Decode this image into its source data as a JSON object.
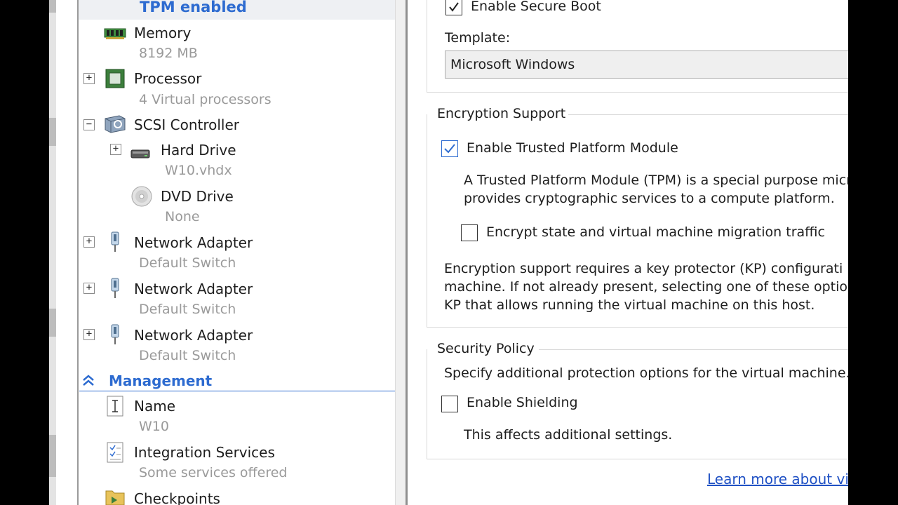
{
  "tree": {
    "selected_item": "TPM enabled",
    "items": [
      {
        "label": "Memory",
        "sub": "8192 MB"
      },
      {
        "label": "Processor",
        "sub": "4 Virtual processors"
      },
      {
        "label": "SCSI Controller"
      },
      {
        "label": "Hard Drive",
        "sub": "W10.vhdx"
      },
      {
        "label": "DVD Drive",
        "sub": "None"
      },
      {
        "label": "Network Adapter",
        "sub": "Default Switch"
      },
      {
        "label": "Network Adapter",
        "sub": "Default Switch"
      },
      {
        "label": "Network Adapter",
        "sub": "Default Switch"
      }
    ],
    "management": {
      "label": "Management",
      "items": [
        {
          "label": "Name",
          "sub": "W10"
        },
        {
          "label": "Integration Services",
          "sub": "Some services offered"
        },
        {
          "label": "Checkpoints"
        }
      ]
    }
  },
  "secure_boot": {
    "checkbox_label": "Enable Secure Boot",
    "checked": true,
    "template_label": "Template:",
    "template_value": "Microsoft Windows"
  },
  "encryption": {
    "group_title": "Encryption Support",
    "tpm_label": "Enable Trusted Platform Module",
    "tpm_checked": true,
    "tpm_desc_line1": "A Trusted Platform Module (TPM) is a special purpose micr",
    "tpm_desc_line2": "provides cryptographic services to a compute platform.",
    "encrypt_label": "Encrypt state and virtual machine migration traffic",
    "encrypt_checked": false,
    "kp_line1": "Encryption support requires a key protector (KP) configurati",
    "kp_line2": "machine. If not already present, selecting one of these optio",
    "kp_line3": "KP that allows running the virtual machine on this host."
  },
  "security_policy": {
    "group_title": "Security Policy",
    "desc": "Specify additional protection options for the virtual machine.",
    "shielding_label": "Enable Shielding",
    "shielding_checked": false,
    "note": "This affects additional settings."
  },
  "learn_more_link": "Learn more about vir",
  "colors": {
    "accent": "#2d6bd0",
    "link": "#2051c4",
    "subtext": "#9a9a9a"
  }
}
